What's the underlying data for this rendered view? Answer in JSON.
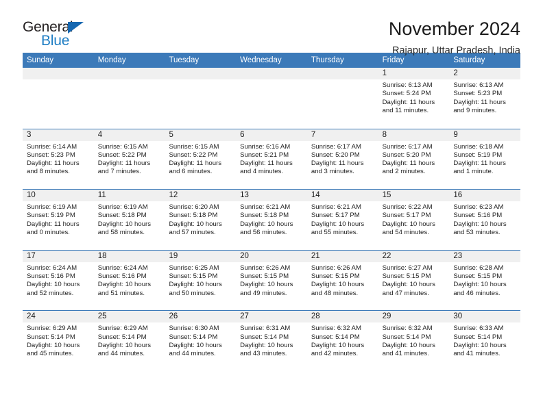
{
  "logo": {
    "word1": "General",
    "word2": "Blue",
    "flag_icon": "triangle-flag-icon",
    "colors": {
      "word2": "#1f7ec4",
      "flag": "#1667b0"
    }
  },
  "header": {
    "title": "November 2024",
    "subtitle": "Rajapur, Uttar Pradesh, India"
  },
  "theme": {
    "header_blue": "#3c7ab9",
    "day_band_gray": "#f0f0f0",
    "row_rule_blue": "#3c7ab9"
  },
  "calendar": {
    "weekdays": [
      "Sunday",
      "Monday",
      "Tuesday",
      "Wednesday",
      "Thursday",
      "Friday",
      "Saturday"
    ],
    "weeks": [
      [
        {
          "day": "",
          "empty": true
        },
        {
          "day": "",
          "empty": true
        },
        {
          "day": "",
          "empty": true
        },
        {
          "day": "",
          "empty": true
        },
        {
          "day": "",
          "empty": true
        },
        {
          "day": "1",
          "sunrise": "Sunrise: 6:13 AM",
          "sunset": "Sunset: 5:24 PM",
          "daylight1": "Daylight: 11 hours",
          "daylight2": "and 11 minutes."
        },
        {
          "day": "2",
          "sunrise": "Sunrise: 6:13 AM",
          "sunset": "Sunset: 5:23 PM",
          "daylight1": "Daylight: 11 hours",
          "daylight2": "and 9 minutes."
        }
      ],
      [
        {
          "day": "3",
          "sunrise": "Sunrise: 6:14 AM",
          "sunset": "Sunset: 5:23 PM",
          "daylight1": "Daylight: 11 hours",
          "daylight2": "and 8 minutes."
        },
        {
          "day": "4",
          "sunrise": "Sunrise: 6:15 AM",
          "sunset": "Sunset: 5:22 PM",
          "daylight1": "Daylight: 11 hours",
          "daylight2": "and 7 minutes."
        },
        {
          "day": "5",
          "sunrise": "Sunrise: 6:15 AM",
          "sunset": "Sunset: 5:22 PM",
          "daylight1": "Daylight: 11 hours",
          "daylight2": "and 6 minutes."
        },
        {
          "day": "6",
          "sunrise": "Sunrise: 6:16 AM",
          "sunset": "Sunset: 5:21 PM",
          "daylight1": "Daylight: 11 hours",
          "daylight2": "and 4 minutes."
        },
        {
          "day": "7",
          "sunrise": "Sunrise: 6:17 AM",
          "sunset": "Sunset: 5:20 PM",
          "daylight1": "Daylight: 11 hours",
          "daylight2": "and 3 minutes."
        },
        {
          "day": "8",
          "sunrise": "Sunrise: 6:17 AM",
          "sunset": "Sunset: 5:20 PM",
          "daylight1": "Daylight: 11 hours",
          "daylight2": "and 2 minutes."
        },
        {
          "day": "9",
          "sunrise": "Sunrise: 6:18 AM",
          "sunset": "Sunset: 5:19 PM",
          "daylight1": "Daylight: 11 hours",
          "daylight2": "and 1 minute."
        }
      ],
      [
        {
          "day": "10",
          "sunrise": "Sunrise: 6:19 AM",
          "sunset": "Sunset: 5:19 PM",
          "daylight1": "Daylight: 11 hours",
          "daylight2": "and 0 minutes."
        },
        {
          "day": "11",
          "sunrise": "Sunrise: 6:19 AM",
          "sunset": "Sunset: 5:18 PM",
          "daylight1": "Daylight: 10 hours",
          "daylight2": "and 58 minutes."
        },
        {
          "day": "12",
          "sunrise": "Sunrise: 6:20 AM",
          "sunset": "Sunset: 5:18 PM",
          "daylight1": "Daylight: 10 hours",
          "daylight2": "and 57 minutes."
        },
        {
          "day": "13",
          "sunrise": "Sunrise: 6:21 AM",
          "sunset": "Sunset: 5:18 PM",
          "daylight1": "Daylight: 10 hours",
          "daylight2": "and 56 minutes."
        },
        {
          "day": "14",
          "sunrise": "Sunrise: 6:21 AM",
          "sunset": "Sunset: 5:17 PM",
          "daylight1": "Daylight: 10 hours",
          "daylight2": "and 55 minutes."
        },
        {
          "day": "15",
          "sunrise": "Sunrise: 6:22 AM",
          "sunset": "Sunset: 5:17 PM",
          "daylight1": "Daylight: 10 hours",
          "daylight2": "and 54 minutes."
        },
        {
          "day": "16",
          "sunrise": "Sunrise: 6:23 AM",
          "sunset": "Sunset: 5:16 PM",
          "daylight1": "Daylight: 10 hours",
          "daylight2": "and 53 minutes."
        }
      ],
      [
        {
          "day": "17",
          "sunrise": "Sunrise: 6:24 AM",
          "sunset": "Sunset: 5:16 PM",
          "daylight1": "Daylight: 10 hours",
          "daylight2": "and 52 minutes."
        },
        {
          "day": "18",
          "sunrise": "Sunrise: 6:24 AM",
          "sunset": "Sunset: 5:16 PM",
          "daylight1": "Daylight: 10 hours",
          "daylight2": "and 51 minutes."
        },
        {
          "day": "19",
          "sunrise": "Sunrise: 6:25 AM",
          "sunset": "Sunset: 5:15 PM",
          "daylight1": "Daylight: 10 hours",
          "daylight2": "and 50 minutes."
        },
        {
          "day": "20",
          "sunrise": "Sunrise: 6:26 AM",
          "sunset": "Sunset: 5:15 PM",
          "daylight1": "Daylight: 10 hours",
          "daylight2": "and 49 minutes."
        },
        {
          "day": "21",
          "sunrise": "Sunrise: 6:26 AM",
          "sunset": "Sunset: 5:15 PM",
          "daylight1": "Daylight: 10 hours",
          "daylight2": "and 48 minutes."
        },
        {
          "day": "22",
          "sunrise": "Sunrise: 6:27 AM",
          "sunset": "Sunset: 5:15 PM",
          "daylight1": "Daylight: 10 hours",
          "daylight2": "and 47 minutes."
        },
        {
          "day": "23",
          "sunrise": "Sunrise: 6:28 AM",
          "sunset": "Sunset: 5:15 PM",
          "daylight1": "Daylight: 10 hours",
          "daylight2": "and 46 minutes."
        }
      ],
      [
        {
          "day": "24",
          "sunrise": "Sunrise: 6:29 AM",
          "sunset": "Sunset: 5:14 PM",
          "daylight1": "Daylight: 10 hours",
          "daylight2": "and 45 minutes."
        },
        {
          "day": "25",
          "sunrise": "Sunrise: 6:29 AM",
          "sunset": "Sunset: 5:14 PM",
          "daylight1": "Daylight: 10 hours",
          "daylight2": "and 44 minutes."
        },
        {
          "day": "26",
          "sunrise": "Sunrise: 6:30 AM",
          "sunset": "Sunset: 5:14 PM",
          "daylight1": "Daylight: 10 hours",
          "daylight2": "and 44 minutes."
        },
        {
          "day": "27",
          "sunrise": "Sunrise: 6:31 AM",
          "sunset": "Sunset: 5:14 PM",
          "daylight1": "Daylight: 10 hours",
          "daylight2": "and 43 minutes."
        },
        {
          "day": "28",
          "sunrise": "Sunrise: 6:32 AM",
          "sunset": "Sunset: 5:14 PM",
          "daylight1": "Daylight: 10 hours",
          "daylight2": "and 42 minutes."
        },
        {
          "day": "29",
          "sunrise": "Sunrise: 6:32 AM",
          "sunset": "Sunset: 5:14 PM",
          "daylight1": "Daylight: 10 hours",
          "daylight2": "and 41 minutes."
        },
        {
          "day": "30",
          "sunrise": "Sunrise: 6:33 AM",
          "sunset": "Sunset: 5:14 PM",
          "daylight1": "Daylight: 10 hours",
          "daylight2": "and 41 minutes."
        }
      ]
    ]
  }
}
